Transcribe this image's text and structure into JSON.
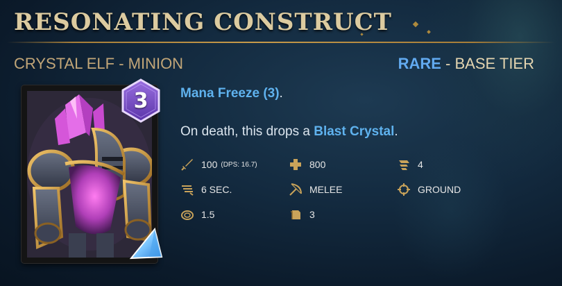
{
  "header": {
    "title": "RESONATING CONSTRUCT",
    "subtitle": "CRYSTAL ELF - MINION",
    "rarity": "RARE",
    "rarity_separator": " - ",
    "tier": "BASE TIER"
  },
  "card": {
    "cost": "3",
    "art_icon": "crystal-golem-art",
    "badge_icon": "blue-crystal-icon"
  },
  "ability": {
    "keyword": "Mana Freeze (3)",
    "keyword_suffix": "."
  },
  "description": {
    "prefix": "On death, this drops a ",
    "keyword": "Blast Crystal",
    "suffix": "."
  },
  "stats": {
    "damage": {
      "icon": "sword-icon",
      "value": "100",
      "extra": "(DPS: 16.7)"
    },
    "health": {
      "icon": "plus-icon",
      "value": "800"
    },
    "speed": {
      "icon": "speed-icon",
      "value": "4"
    },
    "attack_rate": {
      "icon": "attack-speed-icon",
      "value": "6 SEC."
    },
    "range": {
      "icon": "bow-icon",
      "value": "MELEE"
    },
    "target": {
      "icon": "target-icon",
      "value": "GROUND"
    },
    "radius": {
      "icon": "radius-icon",
      "value": "1.5"
    },
    "count": {
      "icon": "cards-icon",
      "value": "3"
    }
  },
  "colors": {
    "gold": "#c69a4a",
    "keyword_blue": "#5fb2ee",
    "cost_purple": "#7a4fc4",
    "text": "#dbe5ee"
  }
}
